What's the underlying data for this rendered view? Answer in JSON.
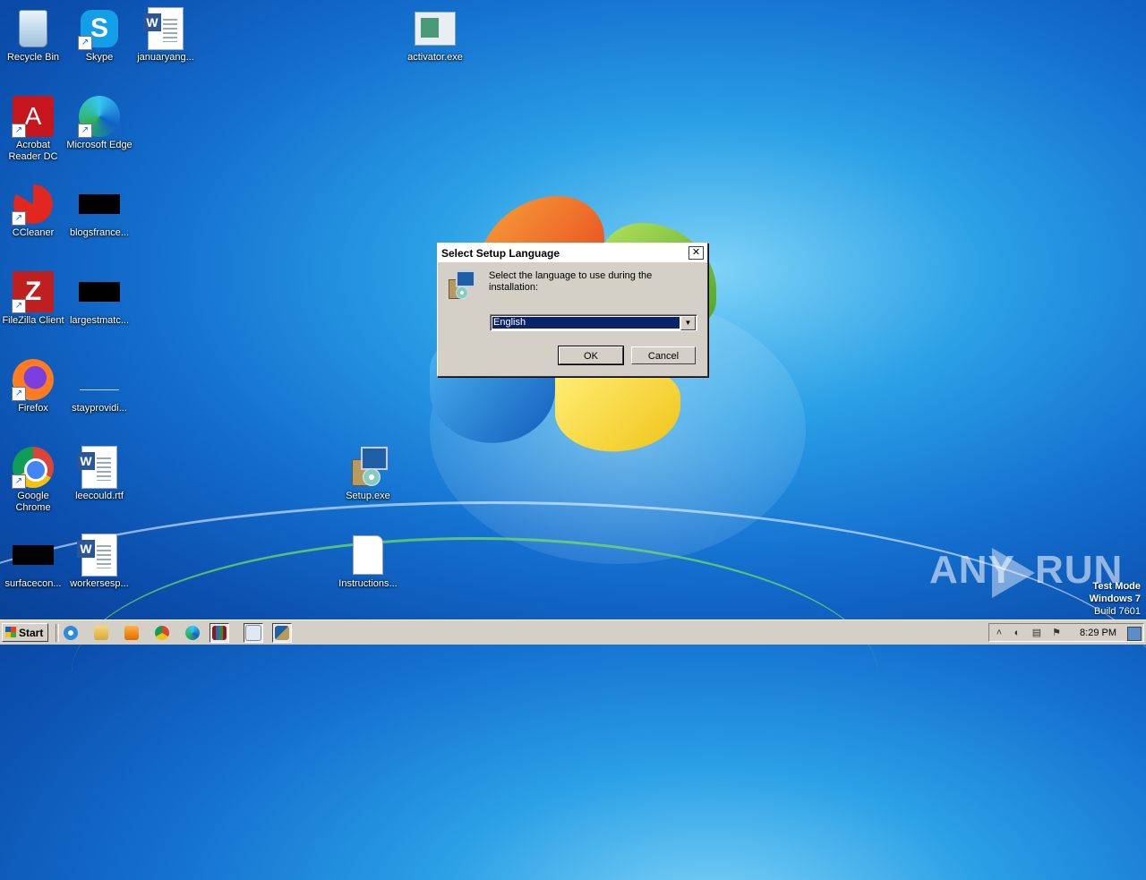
{
  "desktop": {
    "icons": [
      {
        "label": "Recycle Bin"
      },
      {
        "label": "Skype"
      },
      {
        "label": "januaryang..."
      },
      {
        "label": "activator.exe"
      },
      {
        "label": "Acrobat Reader DC"
      },
      {
        "label": "Microsoft Edge"
      },
      {
        "label": "CCleaner"
      },
      {
        "label": "blogsfrance..."
      },
      {
        "label": "FileZilla Client"
      },
      {
        "label": "largestmatc..."
      },
      {
        "label": "Firefox"
      },
      {
        "label": "stayprovidi..."
      },
      {
        "label": "Google Chrome"
      },
      {
        "label": "leecould.rtf"
      },
      {
        "label": "Setup.exe"
      },
      {
        "label": "surfacecon..."
      },
      {
        "label": "workersesp..."
      },
      {
        "label": "Instructions..."
      }
    ]
  },
  "dialog": {
    "title": "Select Setup Language",
    "close": "✕",
    "message": "Select the language to use during the installation:",
    "selected_language": "English",
    "ok_label": "OK",
    "cancel_label": "Cancel"
  },
  "watermark": {
    "brand_left": "ANY",
    "brand_right": "RUN",
    "test_mode": "Test Mode",
    "os": "Windows 7",
    "build": "Build 7601"
  },
  "taskbar": {
    "start_label": "Start",
    "clock": "8:29 PM",
    "pinned": [
      "internet-explorer-icon",
      "file-explorer-icon",
      "media-player-icon",
      "chrome-icon",
      "edge-icon",
      "winrar-icon",
      "notepad-icon",
      "setup-icon"
    ]
  },
  "colors": {
    "desktop_blue": "#1470cf",
    "dialog_face": "#d4d0c8",
    "selection": "#0a246a"
  }
}
